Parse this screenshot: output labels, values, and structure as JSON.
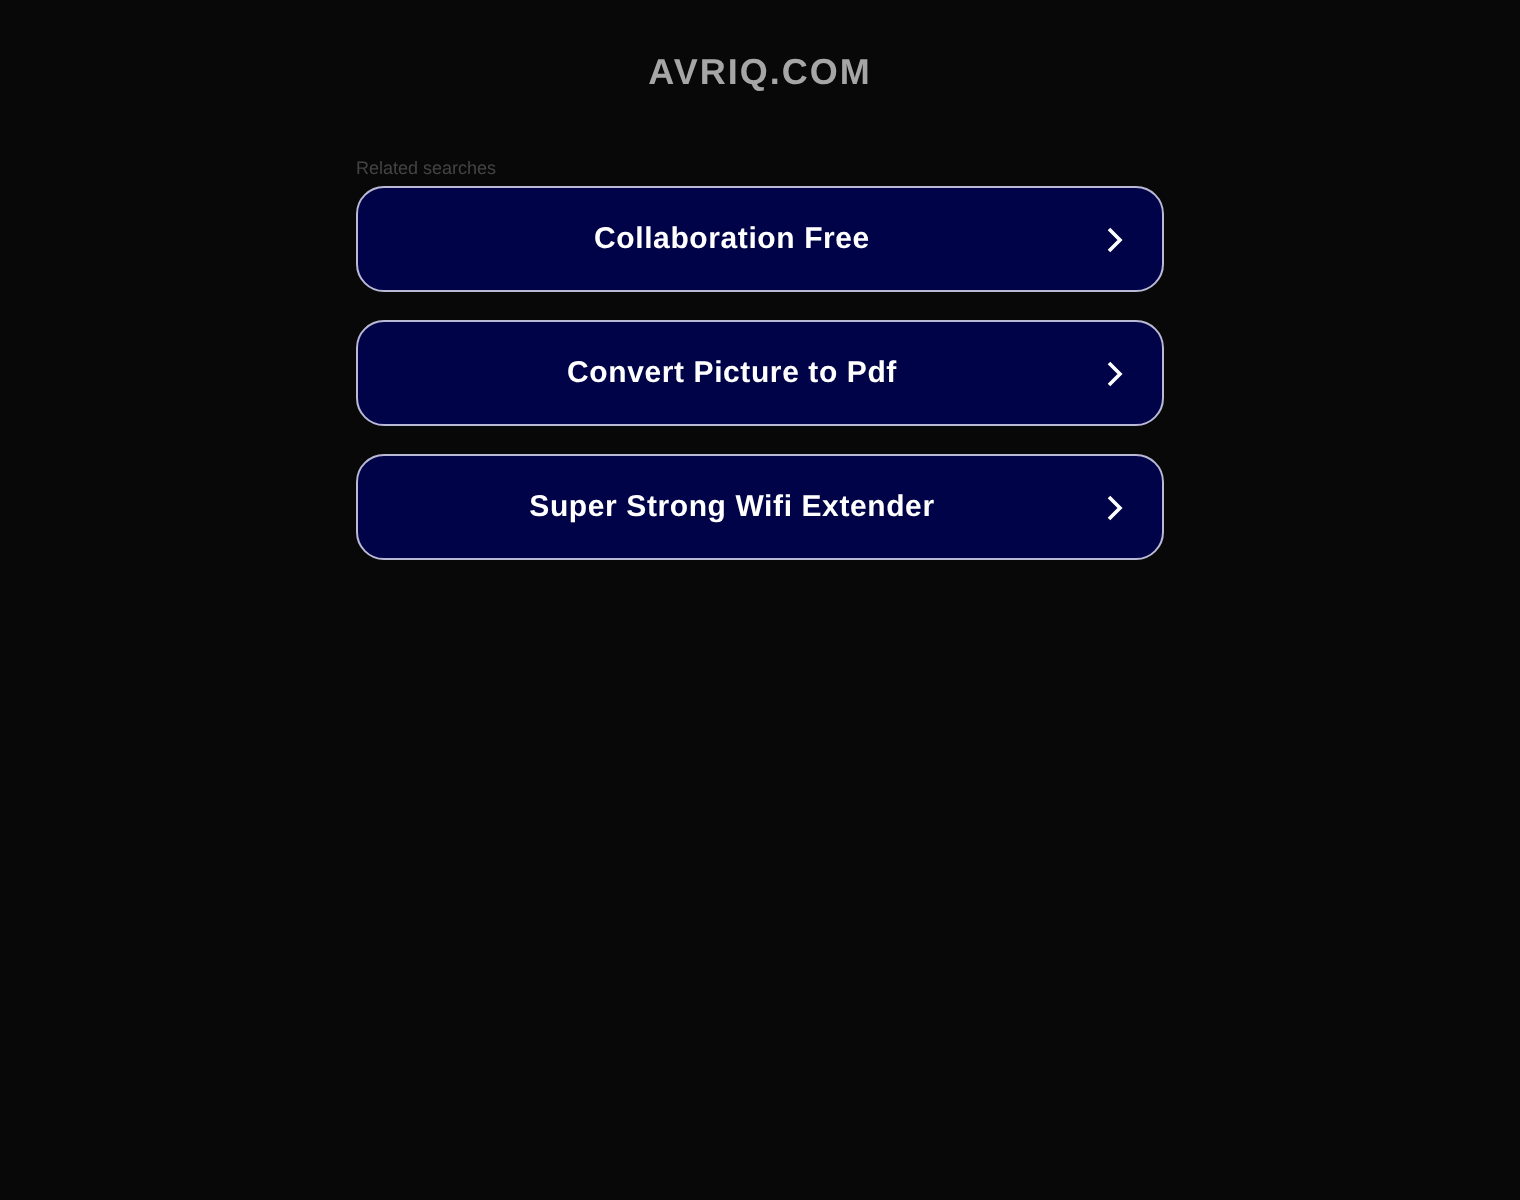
{
  "site_title": "AVRIQ.COM",
  "related_searches": {
    "label": "Related searches",
    "links": [
      {
        "text": "Collaboration Free"
      },
      {
        "text": "Convert Picture to Pdf"
      },
      {
        "text": "Super Strong Wifi Extender"
      }
    ]
  }
}
